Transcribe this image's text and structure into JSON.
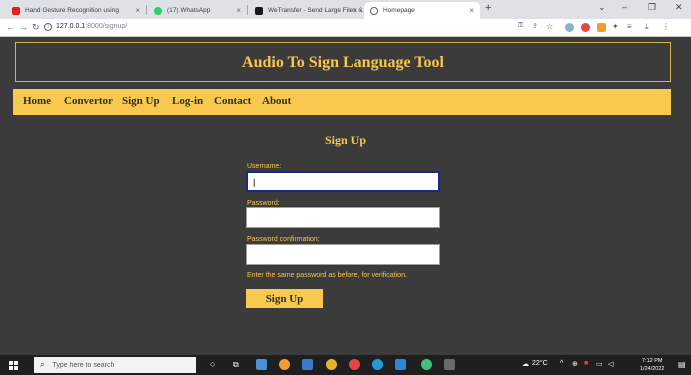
{
  "browser": {
    "tabs": [
      {
        "title": "Hand Gesture Recognition using",
        "favicon_color": "#e62117"
      },
      {
        "title": "(17) WhatsApp",
        "favicon_color": "#25d366"
      },
      {
        "title": "WeTransfer - Send Large Files &",
        "favicon_color": "#17181a"
      },
      {
        "title": "Homepage",
        "favicon_color": "#5f6368"
      }
    ],
    "tab_close": "×",
    "new_tab": "+",
    "url_host": "127.0.0.1",
    "url_path": ":8000/signup/"
  },
  "site": {
    "title": "Audio To Sign Language Tool",
    "nav": [
      "Home",
      "Convertor",
      "Sign Up",
      "Log-in",
      "Contact",
      "About"
    ]
  },
  "form": {
    "title": "Sign Up",
    "username_label": "Username:",
    "username_value": "|",
    "password_label": "Password:",
    "confirm_label": "Password confirmation:",
    "hint": "Enter the same password as before, for verification.",
    "submit_label": "Sign Up"
  },
  "taskbar": {
    "search_placeholder": "Type here to search",
    "weather": "22°C",
    "time": "7:12 PM",
    "date": "1/24/2022"
  },
  "colors": {
    "accent": "#f7c94f",
    "page_bg": "#3b3b3b",
    "focus_border": "#1a2a8c"
  }
}
